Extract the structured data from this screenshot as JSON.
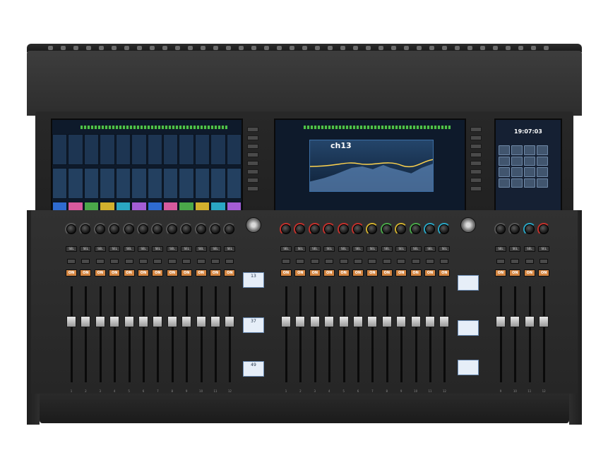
{
  "image": {
    "subject": "digital-mixing-console",
    "background_color": "#ffffff",
    "console_color": "#2d2d2d",
    "fader_cap_color": "#d0d0d0",
    "on_key_color": "#d48642"
  },
  "screens": {
    "center_channel_label": "ch13",
    "right_clock": "19:07:03"
  },
  "strip_keys": {
    "sel_label": "SEL",
    "on_label": "ON"
  },
  "mini_displays": [
    {
      "value": "13"
    },
    {
      "value": "37"
    },
    {
      "value": "49"
    }
  ],
  "strip_numbers": [
    "1",
    "2",
    "3",
    "4",
    "5",
    "6",
    "7",
    "8",
    "9",
    "10",
    "11",
    "12"
  ],
  "master_strip_numbers": [
    "9",
    "10",
    "11",
    "12"
  ]
}
